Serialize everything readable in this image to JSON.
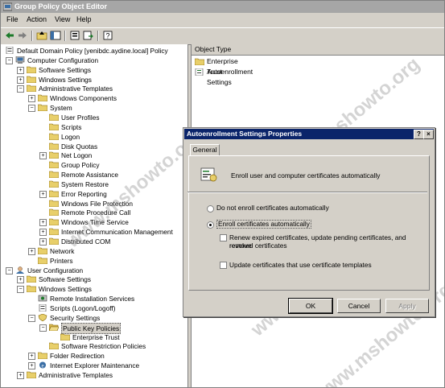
{
  "window": {
    "title": "Group Policy Object Editor"
  },
  "menu": [
    {
      "label": "File",
      "mnemonic": "F"
    },
    {
      "label": "Action",
      "mnemonic": "A"
    },
    {
      "label": "View",
      "mnemonic": "V"
    },
    {
      "label": "Help",
      "mnemonic": "H"
    }
  ],
  "tree": {
    "root": "Default Domain Policy [yenibdc.aydine.local] Policy",
    "items": [
      "Computer Configuration",
      "Software Settings",
      "Windows Settings",
      "Administrative Templates",
      "Windows Components",
      "System",
      "User Profiles",
      "Scripts",
      "Logon",
      "Disk Quotas",
      "Net Logon",
      "Group Policy",
      "Remote Assistance",
      "System Restore",
      "Error Reporting",
      "Windows File Protection",
      "Remote Procedure Call",
      "Windows Time Service",
      "Internet Communication Management",
      "Distributed COM",
      "Network",
      "Printers",
      "User Configuration",
      "Software Settings",
      "Windows Settings",
      "Remote Installation Services",
      "Scripts (Logon/Logoff)",
      "Security Settings",
      "Public Key Policies",
      "Enterprise Trust",
      "Software Restriction Policies",
      "Folder Redirection",
      "Internet Explorer Maintenance",
      "Administrative Templates"
    ]
  },
  "right_pane": {
    "column_header": "Object Type",
    "rows": [
      "Enterprise Trust",
      "Autoenrollment Settings"
    ]
  },
  "dialog": {
    "title": "Autoenrollment Settings Properties",
    "help_btn": "?",
    "close_btn": "×",
    "tab": "General",
    "description": "Enroll user and computer certificates automatically",
    "radio_no": "Do not enroll certificates automatically",
    "radio_yes": "Enroll certificates automatically",
    "chk_renew_line1": "Renew expired certificates, update pending certificates, and remove",
    "chk_renew_line2": "revoked certificates",
    "chk_update": "Update certificates that use certificate templates",
    "ok": "OK",
    "cancel": "Cancel",
    "apply": "Apply"
  },
  "watermark": "www.mshowto.org",
  "colors": {
    "dialog_title": "#0a246a",
    "window_chrome": "#d4d0c8",
    "folder": "#e8cf6a"
  }
}
